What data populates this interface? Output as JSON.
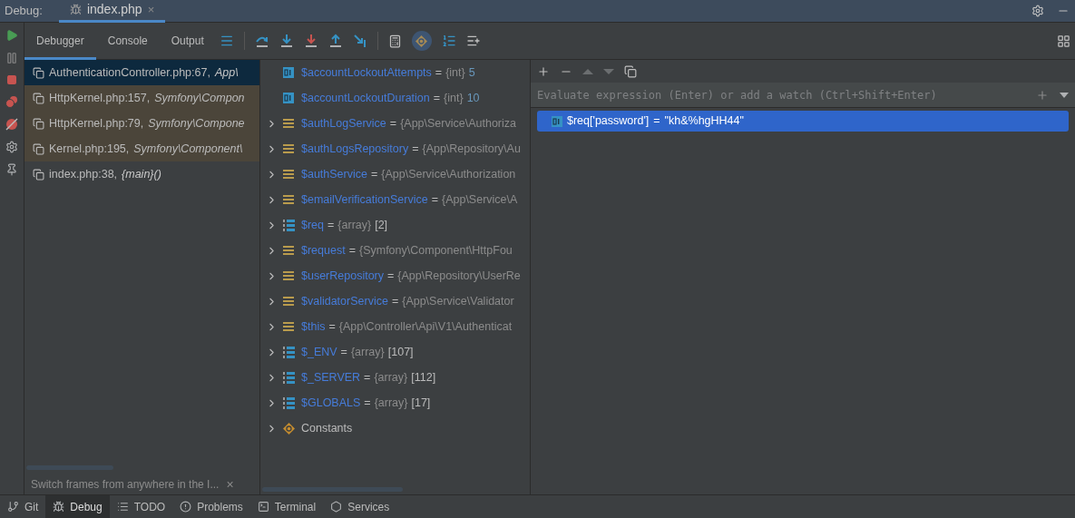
{
  "header": {
    "label": "Debug:",
    "session_tab": {
      "title": "index.php",
      "selected": true,
      "close": "×"
    }
  },
  "tabs": [
    {
      "label": "Debugger",
      "selected": true
    },
    {
      "label": "Console",
      "selected": false
    },
    {
      "label": "Output",
      "selected": false
    }
  ],
  "frames": [
    {
      "location": "AuthenticationController.php:67,",
      "context": "App\\",
      "selected": true,
      "library": false
    },
    {
      "location": "HttpKernel.php:157,",
      "context": "Symfony\\Compon",
      "selected": false,
      "library": true
    },
    {
      "location": "HttpKernel.php:79,",
      "context": "Symfony\\Compone",
      "selected": false,
      "library": true
    },
    {
      "location": "Kernel.php:195,",
      "context": "Symfony\\Component\\",
      "selected": false,
      "library": true
    },
    {
      "location": "index.php:38,",
      "context": "{main}()",
      "selected": false,
      "library": false
    }
  ],
  "frames_tip": {
    "text": "Switch frames from anywhere in the I...",
    "close": "×"
  },
  "variables": [
    {
      "kind": "primitive",
      "expandable": false,
      "name": "$accountLockoutAttempts",
      "sep": "=",
      "type": "{int}",
      "value": "5"
    },
    {
      "kind": "primitive",
      "expandable": false,
      "name": "$accountLockoutDuration",
      "sep": "=",
      "type": "{int}",
      "value": "10"
    },
    {
      "kind": "object",
      "expandable": true,
      "name": "$authLogService",
      "sep": "=",
      "type": "{App\\Service\\Authoriza"
    },
    {
      "kind": "object",
      "expandable": true,
      "name": "$authLogsRepository",
      "sep": "=",
      "type": "{App\\Repository\\Au"
    },
    {
      "kind": "object",
      "expandable": true,
      "name": "$authService",
      "sep": "=",
      "type": "{App\\Service\\Authorization"
    },
    {
      "kind": "object",
      "expandable": true,
      "name": "$emailVerificationService",
      "sep": "=",
      "type": "{App\\Service\\A"
    },
    {
      "kind": "array",
      "expandable": true,
      "name": "$req",
      "sep": "=",
      "type": "{array}",
      "value": "[2]"
    },
    {
      "kind": "object",
      "expandable": true,
      "name": "$request",
      "sep": "=",
      "type": "{Symfony\\Component\\HttpFou"
    },
    {
      "kind": "object",
      "expandable": true,
      "name": "$userRepository",
      "sep": "=",
      "type": "{App\\Repository\\UserRe"
    },
    {
      "kind": "object",
      "expandable": true,
      "name": "$validatorService",
      "sep": "=",
      "type": "{App\\Service\\Validator"
    },
    {
      "kind": "object",
      "expandable": true,
      "name": "$this",
      "sep": "=",
      "type": "{App\\Controller\\Api\\V1\\Authenticat"
    },
    {
      "kind": "array",
      "expandable": true,
      "name": "$_ENV",
      "sep": "=",
      "type": "{array}",
      "value": "[107]"
    },
    {
      "kind": "array",
      "expandable": true,
      "name": "$_SERVER",
      "sep": "=",
      "type": "{array}",
      "value": "[112]"
    },
    {
      "kind": "array",
      "expandable": true,
      "name": "$GLOBALS",
      "sep": "=",
      "type": "{array}",
      "value": "[17]"
    },
    {
      "kind": "constants",
      "expandable": true,
      "name": "Constants"
    }
  ],
  "watches": {
    "placeholder": "Evaluate expression (Enter) or add a watch (Ctrl+Shift+Enter)",
    "items": [
      {
        "expression": "$req['password']",
        "sep": "=",
        "value": "\"kh&%hgHH44\"",
        "selected": true
      }
    ]
  },
  "bottom_tabs": [
    {
      "label": "Git",
      "selected": false
    },
    {
      "label": "Debug",
      "selected": true
    },
    {
      "label": "TODO",
      "selected": false
    },
    {
      "label": "Problems",
      "selected": false
    },
    {
      "label": "Terminal",
      "selected": false
    },
    {
      "label": "Services",
      "selected": false
    }
  ]
}
